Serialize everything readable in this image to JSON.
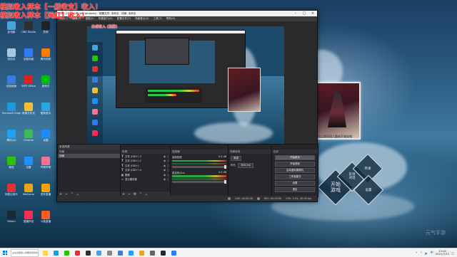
{
  "overlay": {
    "line1": "模拟收入样本【一般收支】收入！",
    "line2": "模拟收入样本【网红】收入！",
    "line3": "分成收入 (直播)"
  },
  "obs": {
    "title": "OBS 27.1.3 (64-bit, windows) - 配置文件: 未命名 - 场景: 未命名",
    "menu": [
      "文件(F)",
      "编辑(E)",
      "视图(V)",
      "停靠窗口(D)",
      "配置文件(P)",
      "场景集合(S)",
      "工具(T)",
      "帮助(H)"
    ],
    "source_bar_label": "未选择源",
    "scenes_title": "场景",
    "scenes": [
      "场景"
    ],
    "sources_title": "来源",
    "sources": [
      {
        "icon": "T",
        "name": "文本 (GDI+) 3"
      },
      {
        "icon": "T",
        "name": "文本 (GDI+) 2"
      },
      {
        "icon": "T",
        "name": "文本 (GDI+)"
      },
      {
        "icon": "T",
        "name": "文本 (GDI+) 4"
      },
      {
        "icon": "▣",
        "name": "图像"
      },
      {
        "icon": "▭",
        "name": "显示器采集"
      }
    ],
    "mixer_title": "混音器",
    "mixer": [
      {
        "name": "桌面音频",
        "db": "0.0 dB"
      },
      {
        "name": "麦克风/Aux",
        "db": "0.0 dB"
      }
    ],
    "transitions_title": "场景转场",
    "transition_label": "渐变",
    "duration_label": "时长",
    "duration_value": "300 ms",
    "controls_title": "控件",
    "controls": [
      "开始推流",
      "开始录制",
      "启动虚拟摄像机",
      "工作室模式",
      "设置",
      "退出"
    ],
    "status": {
      "live": "LIVE: 00:00:00",
      "rec": "REC: 00:00:00",
      "cpu": "CPU: 3.5%, 30.00 fps"
    }
  },
  "wallpaper": {
    "caption": "FTG  十二周年同人趣味开端攻略",
    "badge_start": "开始\n游戏",
    "badge_settings": "设置",
    "badge_story": "史诗\n对话",
    "badge_record": "传承",
    "watermark": "元气手游"
  },
  "desktop_icons": [
    {
      "label": "此电脑",
      "color": "#4aa3df"
    },
    {
      "label": "回收站",
      "color": "#a7c7e7"
    },
    {
      "label": "控制面板",
      "color": "#3b7dd8"
    },
    {
      "label": "Microsoft Edge",
      "color": "#1a9bd7"
    },
    {
      "label": "腾讯QQ",
      "color": "#20a0f0"
    },
    {
      "label": "微信",
      "color": "#2dc100"
    },
    {
      "label": "网易云音乐",
      "color": "#d33"
    },
    {
      "label": "Steam",
      "color": "#1b2838"
    },
    {
      "label": "OBS Studio",
      "color": "#302e31"
    },
    {
      "label": "百度网盘",
      "color": "#2f7bf5"
    },
    {
      "label": "WPS Office",
      "color": "#d22"
    },
    {
      "label": "新建文件夹",
      "color": "#f2c037"
    },
    {
      "label": "Chrome",
      "color": "#3cba54"
    },
    {
      "label": "迅雷",
      "color": "#1e90ff"
    },
    {
      "label": "WeGame",
      "color": "#e8a317"
    },
    {
      "label": "直播伴侣",
      "color": "#fe2c55"
    },
    {
      "label": "剪映",
      "color": "#222"
    },
    {
      "label": "腾讯视频",
      "color": "#ff7b00"
    },
    {
      "label": "爱奇艺",
      "color": "#00be06"
    },
    {
      "label": "酷狗音乐",
      "color": "#2ca6e0"
    },
    {
      "label": "优酷",
      "color": "#1e88ff"
    },
    {
      "label": "哔哩哔哩",
      "color": "#fb7299"
    },
    {
      "label": "虎牙直播",
      "color": "#ffa200"
    },
    {
      "label": "斗鱼直播",
      "color": "#ff5d23"
    }
  ],
  "taskbar": {
    "search_placeholder": "在这里输入你要搜索的内容",
    "apps": [
      "#ffd54f",
      "#1a9bd7",
      "#2dc100",
      "#d33",
      "#302e31",
      "#4aa3df",
      "#888",
      "#3b7dd8",
      "#20a0f0",
      "#e8a317",
      "#666",
      "#1b2838",
      "#2f7bf5"
    ],
    "time": "13:00",
    "date": "2021/7/11",
    "ime": "中"
  },
  "colors": {
    "accent": "#0078d7",
    "overlay_text": "#ff2020",
    "obs_bg": "#2a2a2d"
  }
}
